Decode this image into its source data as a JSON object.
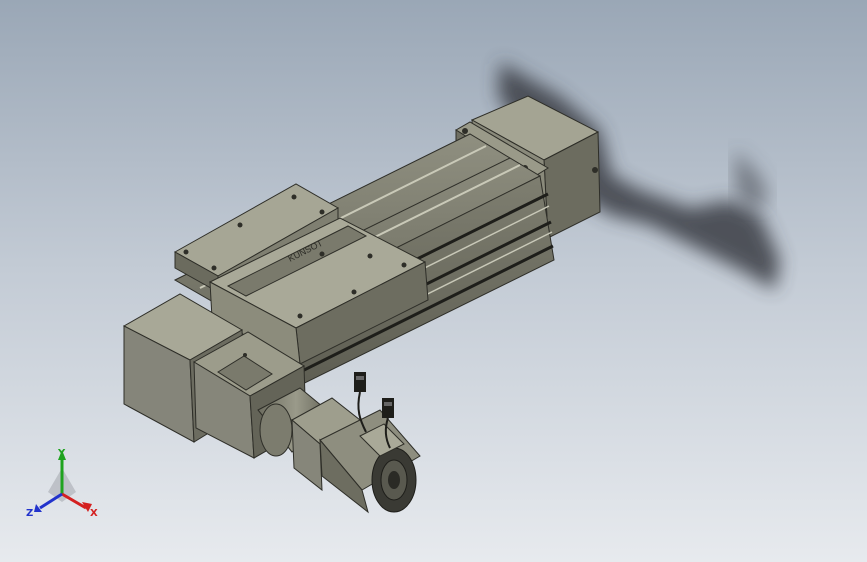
{
  "viewport": {
    "background_top": "#9aa7b6",
    "background_bottom": "#e7eaee"
  },
  "model": {
    "engraved_label": "KUNSOT"
  },
  "triad": {
    "x_label": "X",
    "y_label": "Y",
    "z_label": "Z",
    "x_color": "#d42020",
    "y_color": "#1fa31f",
    "z_color": "#2233cc"
  },
  "icons": [
    "axis-triad-icon",
    "connector-icon"
  ]
}
